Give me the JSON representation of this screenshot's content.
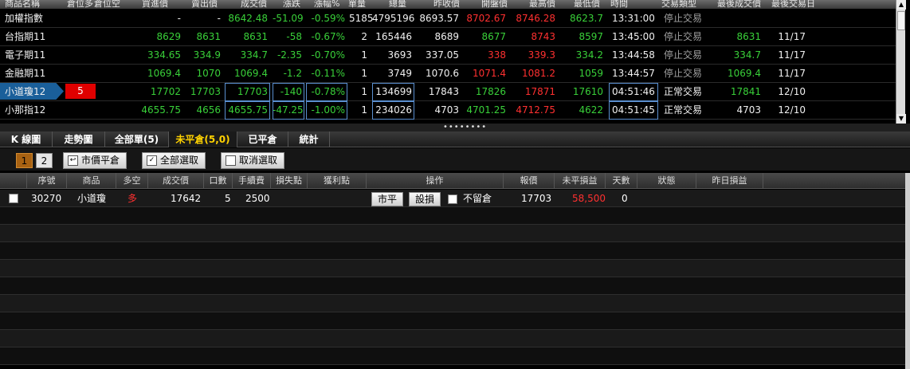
{
  "quote_table": {
    "headers": [
      "商品名稱",
      "倉位多",
      "倉位空",
      "買進價",
      "賣出價",
      "成交價",
      "漲跌",
      "漲幅%",
      "單量",
      "總量",
      "昨收價",
      "開盤價",
      "最高價",
      "最低價",
      "時間",
      "交易類型",
      "最後成交價",
      "最後交易日"
    ],
    "rows": [
      {
        "name": "加權指數",
        "pos_long": "",
        "pos_short": "",
        "bid": "-",
        "ask": "-",
        "last": "8642.48",
        "change": "-51.09",
        "pct": "-0.59%",
        "vol": "5185",
        "total": "4795196",
        "prev": "8693.57",
        "open": "8702.67",
        "high": "8746.28",
        "low": "8623.7",
        "time": "13:31:00",
        "status": "停止交易",
        "last_trade": "",
        "last_day": ""
      },
      {
        "name": "台指期11",
        "pos_long": "",
        "pos_short": "",
        "bid": "8629",
        "ask": "8631",
        "last": "8631",
        "change": "-58",
        "pct": "-0.67%",
        "vol": "2",
        "total": "165446",
        "prev": "8689",
        "open": "8677",
        "high": "8743",
        "low": "8597",
        "time": "13:45:00",
        "status": "停止交易",
        "last_trade": "8631",
        "last_day": "11/17"
      },
      {
        "name": "電子期11",
        "pos_long": "",
        "pos_short": "",
        "bid": "334.65",
        "ask": "334.9",
        "last": "334.7",
        "change": "-2.35",
        "pct": "-0.70%",
        "vol": "1",
        "total": "3693",
        "prev": "337.05",
        "open": "338",
        "high": "339.3",
        "low": "334.2",
        "time": "13:44:58",
        "status": "停止交易",
        "last_trade": "334.7",
        "last_day": "11/17"
      },
      {
        "name": "金融期11",
        "pos_long": "",
        "pos_short": "",
        "bid": "1069.4",
        "ask": "1070",
        "last": "1069.4",
        "change": "-1.2",
        "pct": "-0.11%",
        "vol": "1",
        "total": "3749",
        "prev": "1070.6",
        "open": "1071.4",
        "high": "1081.2",
        "low": "1059",
        "time": "13:44:57",
        "status": "停止交易",
        "last_trade": "1069.4",
        "last_day": "11/17"
      },
      {
        "name": "小道瓊12",
        "pos_long": "",
        "pos_short": "5",
        "bid": "17702",
        "ask": "17703",
        "last": "17703",
        "change": "-140",
        "pct": "-0.78%",
        "vol": "1",
        "total": "134699",
        "prev": "17843",
        "open": "17826",
        "high": "17871",
        "low": "17610",
        "time": "04:51:46",
        "status": "正常交易",
        "last_trade": "17841",
        "last_day": "12/10"
      },
      {
        "name": "小那指12",
        "pos_long": "",
        "pos_short": "",
        "bid": "4655.75",
        "ask": "4656",
        "last": "4655.75",
        "change": "-47.25",
        "pct": "-1.00%",
        "vol": "1",
        "total": "234026",
        "prev": "4703",
        "open": "4701.25",
        "high": "4712.75",
        "low": "4622",
        "time": "04:51:45",
        "status": "正常交易",
        "last_trade": "4703",
        "last_day": "12/10"
      }
    ]
  },
  "splitter_dots": "••••••••",
  "tabs": [
    "K 線圖",
    "走勢圖",
    "全部單(5)",
    "未平倉(5,0)",
    "已平倉",
    "統計"
  ],
  "toolbar": {
    "page1": "1",
    "page2": "2",
    "market_close": "市價平倉",
    "select_all": "全部選取",
    "deselect": "取消選取"
  },
  "positions": {
    "headers": [
      "序號",
      "商品",
      "多空",
      "成交價",
      "口數",
      "手續費",
      "損失點",
      "獲利點",
      "操作",
      "報價",
      "未平損益",
      "天數",
      "狀態",
      "昨日損益"
    ],
    "rows": [
      {
        "seq": "30270",
        "product": "小道瓊",
        "side": "多",
        "price": "17642",
        "qty": "5",
        "fee": "2500",
        "op_close": "市平",
        "op_set": "設損",
        "keep_label": "不留倉",
        "quote": "17703",
        "pnl": "58,500",
        "days": "0"
      }
    ]
  },
  "colors": {
    "up": "#39d039",
    "down": "#ff3030",
    "active_tab": "#ffd200"
  }
}
